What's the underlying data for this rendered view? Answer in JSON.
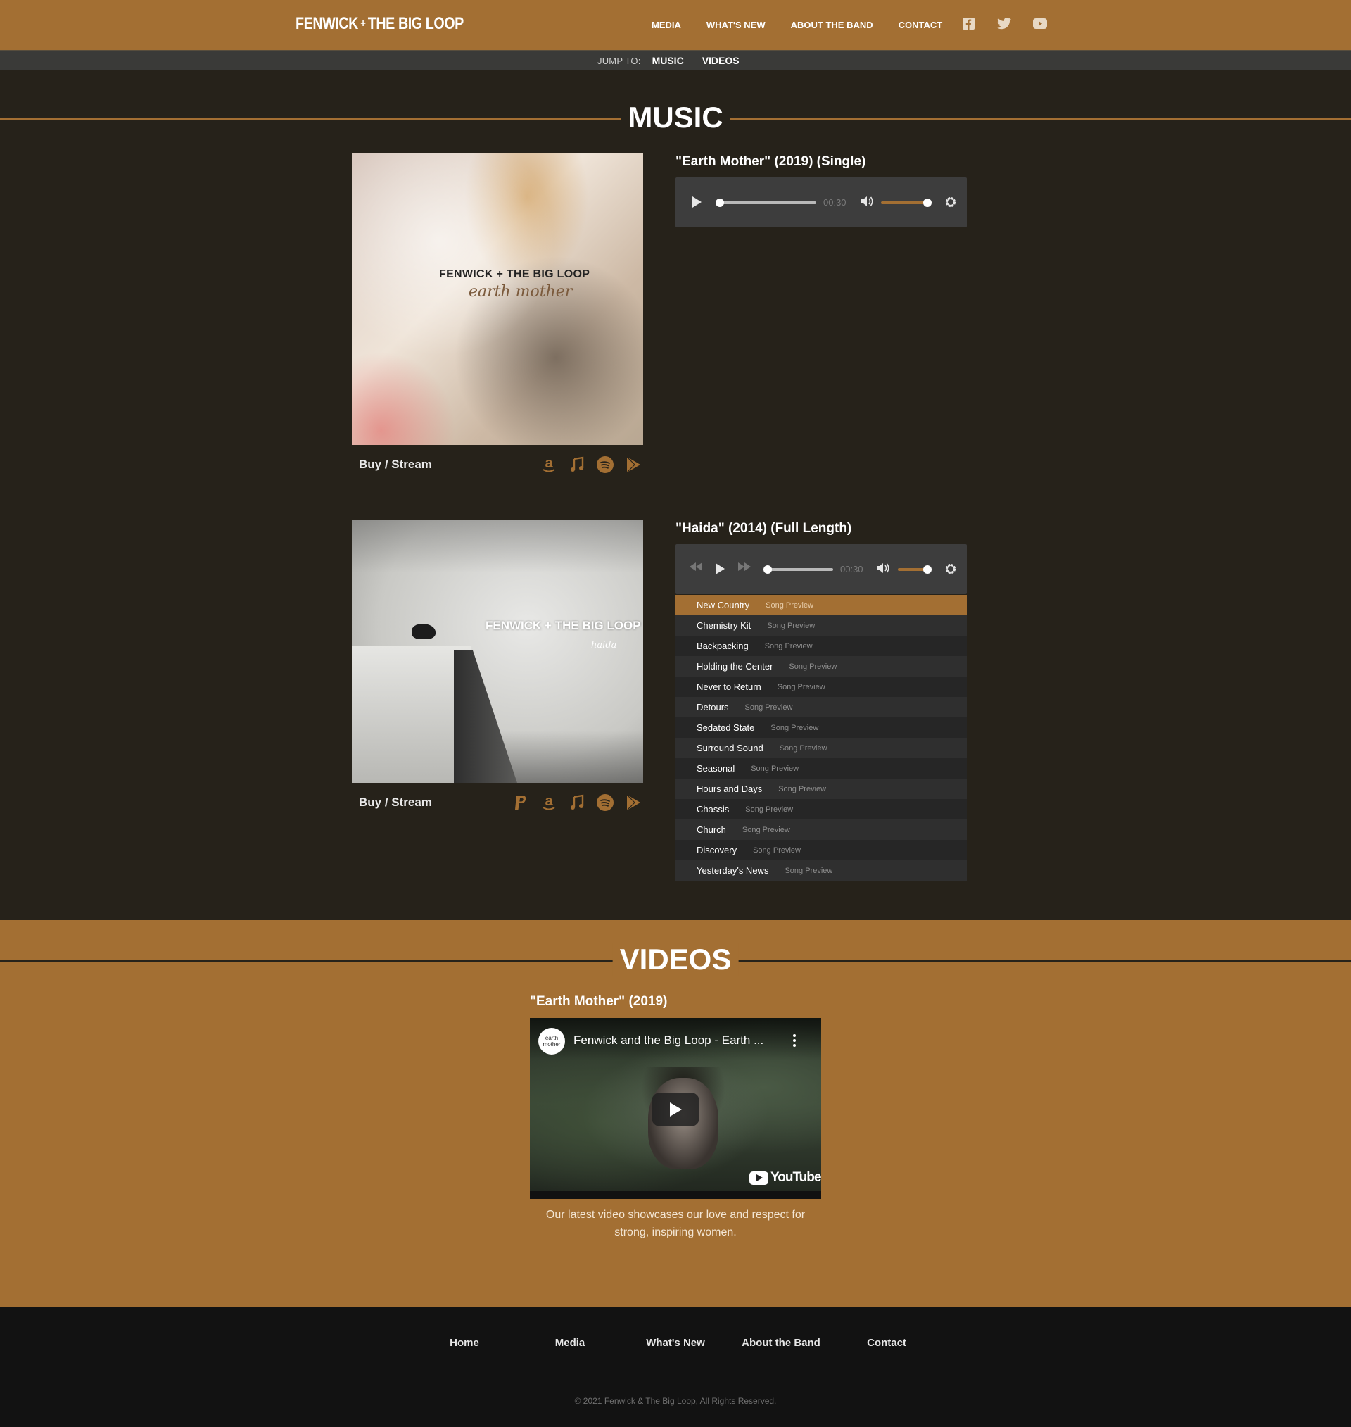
{
  "header": {
    "logo_left": "FENWICK",
    "logo_amp": "+",
    "logo_right": "THE BIG LOOP",
    "nav": [
      "MEDIA",
      "WHAT'S NEW",
      "ABOUT THE BAND",
      "CONTACT"
    ],
    "social_icons": [
      "facebook-icon",
      "twitter-icon",
      "youtube-icon"
    ]
  },
  "jump": {
    "label": "JUMP TO:",
    "links": [
      "MUSIC",
      "VIDEOS"
    ]
  },
  "music": {
    "title": "MUSIC",
    "albums": [
      {
        "title": "\"Earth Mother\" (2019) (Single)",
        "cover_band": "FENWICK + THE BIG LOOP",
        "cover_script": "earth mother",
        "buy_label": "Buy / Stream",
        "buy_icons": [
          "amazon-icon",
          "itunes-icon",
          "spotify-icon",
          "google-play-icon"
        ],
        "player": {
          "time": "00:30"
        }
      },
      {
        "title": "\"Haida\" (2014) (Full Length)",
        "cover_band": "FENWICK + THE BIG LOOP",
        "cover_script": "haida",
        "buy_label": "Buy / Stream",
        "buy_icons": [
          "paypal-icon",
          "amazon-icon",
          "itunes-icon",
          "spotify-icon",
          "google-play-icon"
        ],
        "player": {
          "time": "00:30"
        },
        "tracks": [
          {
            "name": "New Country",
            "sub": "Song Preview"
          },
          {
            "name": "Chemistry Kit",
            "sub": "Song Preview"
          },
          {
            "name": "Backpacking",
            "sub": "Song Preview"
          },
          {
            "name": "Holding the Center",
            "sub": "Song Preview"
          },
          {
            "name": "Never to Return",
            "sub": "Song Preview"
          },
          {
            "name": "Detours",
            "sub": "Song Preview"
          },
          {
            "name": "Sedated State",
            "sub": "Song Preview"
          },
          {
            "name": "Surround Sound",
            "sub": "Song Preview"
          },
          {
            "name": "Seasonal",
            "sub": "Song Preview"
          },
          {
            "name": "Hours and Days",
            "sub": "Song Preview"
          },
          {
            "name": "Chassis",
            "sub": "Song Preview"
          },
          {
            "name": "Church",
            "sub": "Song Preview"
          },
          {
            "name": "Discovery",
            "sub": "Song Preview"
          },
          {
            "name": "Yesterday's News",
            "sub": "Song Preview"
          }
        ],
        "active_track": 0
      }
    ]
  },
  "videos": {
    "title": "VIDEOS",
    "items": [
      {
        "title": "\"Earth Mother\" (2019)",
        "yt_title": "Fenwick and the Big Loop - Earth ...",
        "yt_avatar": "earth mother",
        "yt_brand": "YouTube",
        "caption": "Our latest video showcases our love and respect for strong, inspiring women."
      }
    ]
  },
  "footer": {
    "links": [
      "Home",
      "Media",
      "What's New",
      "About the Band",
      "Contact"
    ],
    "copyright": "© 2021 Fenwick & The Big Loop, All Rights Reserved."
  },
  "colors": {
    "accent": "#a36f33",
    "background": "#26221a",
    "footer": "#121212"
  }
}
